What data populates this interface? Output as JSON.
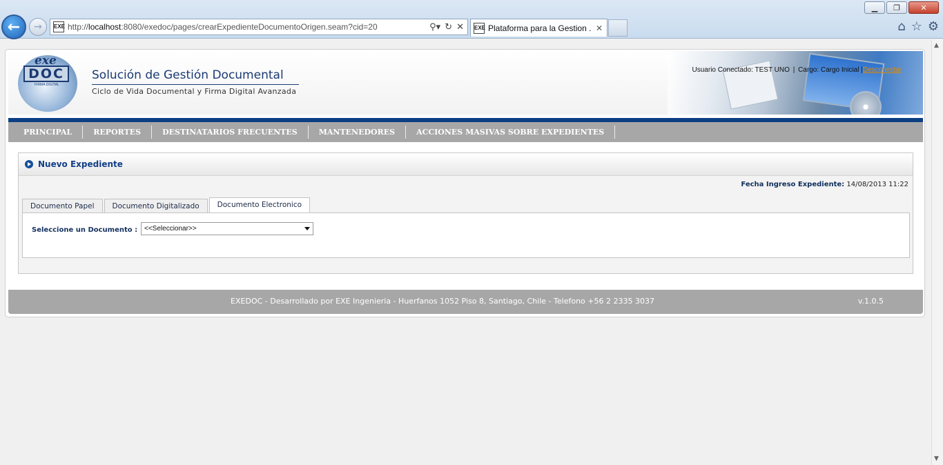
{
  "browser": {
    "address_prefix": "http://",
    "address_host": "localhost",
    "address_rest": ":8080/exedoc/pages/crearExpedienteDocumentoOrigen.seam?cid=20",
    "tab_title": "Plataforma para la Gestion ...",
    "favicon_text": "EXE",
    "window_buttons": [
      "▁",
      "❐",
      "✕"
    ],
    "addr_icons": [
      "⚲▾",
      "↻",
      "✕"
    ],
    "right_icons": [
      "⌂",
      "☆",
      "⚙"
    ]
  },
  "header": {
    "logo_exe": "exe",
    "logo_doc": "DOC",
    "logo_sub": "FIRMA DIGITAL",
    "title": "Solución de Gestión Documental",
    "subtitle": "Ciclo de Vida Documental y Firma Digital Avanzada",
    "user_label": "Usuario Conectado:",
    "user_name": "TEST UNO",
    "cargo_label": "Cargo:",
    "cargo_value": "Cargo Inicial",
    "logout": "Desconectar"
  },
  "menu": {
    "items": [
      {
        "label": "PRINCIPAL"
      },
      {
        "label": "REPORTES"
      },
      {
        "label": "DESTINATARIOS FRECUENTES"
      },
      {
        "label": "MANTENEDORES"
      },
      {
        "label": "ACCIONES MASIVAS SOBRE EXPEDIENTES"
      }
    ]
  },
  "panel": {
    "title": "Nuevo Expediente",
    "fecha_label": "Fecha Ingreso Expediente:",
    "fecha_value": "14/08/2013 11:22",
    "tabs": [
      {
        "label": "Documento Papel"
      },
      {
        "label": "Documento Digitalizado"
      },
      {
        "label": "Documento Electronico"
      }
    ],
    "active_tab": "Documento Electronico",
    "select_label": "Seleccione un Documento :",
    "select_value": "<<Seleccionar>>"
  },
  "footer": {
    "text": "EXEDOC - Desarrollado por EXE Ingenieria - Huerfanos 1052 Piso 8, Santiago, Chile - Telefono +56 2 2335 3037",
    "version": "v.1.0.5"
  },
  "colors": {
    "menu_bg": "#a7a7a7",
    "menu_border": "#0b3e83",
    "title_blue": "#123f88",
    "logout": "#e08a00"
  }
}
